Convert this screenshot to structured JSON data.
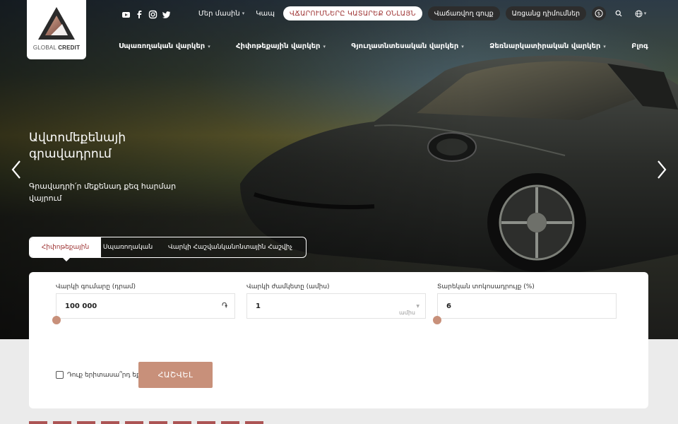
{
  "brand": {
    "name_part1": "GLOBAL",
    "name_part2": "CREDIT",
    "accent_color": "#9c2f2f",
    "button_color": "#c8907a"
  },
  "social": [
    "youtube-icon",
    "facebook-icon",
    "instagram-icon",
    "twitter-icon"
  ],
  "topbar": {
    "about": "Մեր մասին",
    "contact": "Կապ",
    "pay_loans": "ՎՃԱՐՈՒՄՆԵՐԸ ԿԱՏԱՐԵՔ ՕՆԼԱՅՆ",
    "sales_list": "Վաճառվող գույք",
    "online_apply": "Առցանց դիմումներ"
  },
  "nav": {
    "consumer": "Սպառողական վարկեր",
    "mortgage": "Հիփոթեքային վարկեր",
    "agri": "Գյուղատնտեսական վարկեր",
    "business": "Ձեռնարկատիրական վարկեր",
    "blog": "Բլոգ"
  },
  "hero": {
    "title": "Ավտոմեքենայի գրավադրում",
    "subtitle": "Գրավադրի՛ր մեքենադ քեզ հարմար վայրում"
  },
  "tabs": {
    "mortgage": "Հիփոթեքային",
    "consumer": "Սպառողական",
    "calculator": "Վարկի Հաշվանկանոնտային Հաշվիչ"
  },
  "calculator": {
    "amount_label": "Վարկի գումարը (դրամ)",
    "amount_value": "100 000",
    "amount_suffix": "֏",
    "term_label": "Վարկի ժամկետը (ամիս)",
    "term_value": "1",
    "term_unit": "ամիս",
    "rate_label": "Տարեկան տոկոսադրույք (%)",
    "rate_value": "6",
    "youth_label": "Դուք երիտասա՞րդ եք",
    "button": "ՀԱՇՎԵԼ"
  }
}
